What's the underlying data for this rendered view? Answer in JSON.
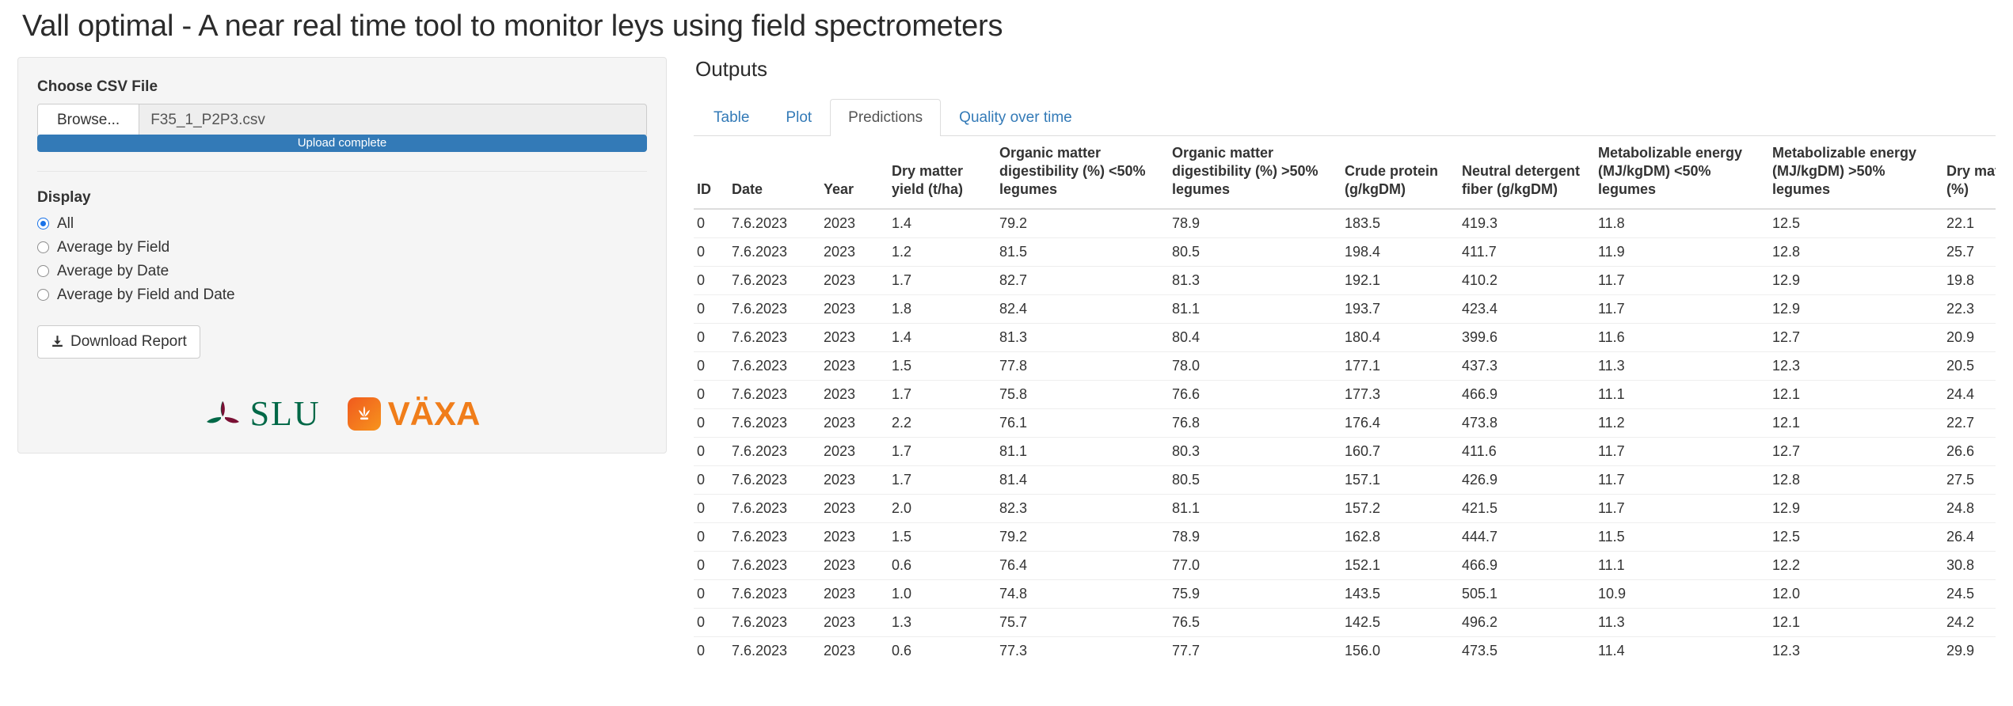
{
  "app": {
    "title": "Vall optimal - A near real time tool to monitor leys using field spectrometers"
  },
  "sidebar": {
    "file_label": "Choose CSV File",
    "browse_button": "Browse...",
    "file_name": "F35_1_P2P3.csv",
    "upload_status": "Upload complete",
    "display_label": "Display",
    "display_options": [
      {
        "label": "All",
        "selected": true
      },
      {
        "label": "Average by Field",
        "selected": false
      },
      {
        "label": "Average by Date",
        "selected": false
      },
      {
        "label": "Average by Field and Date",
        "selected": false
      }
    ],
    "download_button": "Download Report",
    "logos": [
      {
        "name": "slu-logo",
        "text": "SLU"
      },
      {
        "name": "vaxa-logo",
        "text": "VÄXA"
      }
    ]
  },
  "outputs": {
    "title": "Outputs",
    "tabs": [
      {
        "label": "Table",
        "active": false
      },
      {
        "label": "Plot",
        "active": false
      },
      {
        "label": "Predictions",
        "active": true
      },
      {
        "label": "Quality over time",
        "active": false
      }
    ],
    "table": {
      "columns": [
        "ID",
        "Date",
        "Year",
        "Dry matter yield (t/ha)",
        "Organic matter digestibility (%) <50% legumes",
        "Organic matter digestibility (%) >50% legumes",
        "Crude protein (g/kgDM)",
        "Neutral detergent fiber (g/kgDM)",
        "Metabolizable energy (MJ/kgDM) <50% legumes",
        "Metabolizable energy (MJ/kgDM) >50% legumes",
        "Dry matter (%)"
      ],
      "rows": [
        [
          "0",
          "7.6.2023",
          "2023",
          "1.4",
          "79.2",
          "78.9",
          "183.5",
          "419.3",
          "11.8",
          "12.5",
          "22.1"
        ],
        [
          "0",
          "7.6.2023",
          "2023",
          "1.2",
          "81.5",
          "80.5",
          "198.4",
          "411.7",
          "11.9",
          "12.8",
          "25.7"
        ],
        [
          "0",
          "7.6.2023",
          "2023",
          "1.7",
          "82.7",
          "81.3",
          "192.1",
          "410.2",
          "11.7",
          "12.9",
          "19.8"
        ],
        [
          "0",
          "7.6.2023",
          "2023",
          "1.8",
          "82.4",
          "81.1",
          "193.7",
          "423.4",
          "11.7",
          "12.9",
          "22.3"
        ],
        [
          "0",
          "7.6.2023",
          "2023",
          "1.4",
          "81.3",
          "80.4",
          "180.4",
          "399.6",
          "11.6",
          "12.7",
          "20.9"
        ],
        [
          "0",
          "7.6.2023",
          "2023",
          "1.5",
          "77.8",
          "78.0",
          "177.1",
          "437.3",
          "11.3",
          "12.3",
          "20.5"
        ],
        [
          "0",
          "7.6.2023",
          "2023",
          "1.7",
          "75.8",
          "76.6",
          "177.3",
          "466.9",
          "11.1",
          "12.1",
          "24.4"
        ],
        [
          "0",
          "7.6.2023",
          "2023",
          "2.2",
          "76.1",
          "76.8",
          "176.4",
          "473.8",
          "11.2",
          "12.1",
          "22.7"
        ],
        [
          "0",
          "7.6.2023",
          "2023",
          "1.7",
          "81.1",
          "80.3",
          "160.7",
          "411.6",
          "11.7",
          "12.7",
          "26.6"
        ],
        [
          "0",
          "7.6.2023",
          "2023",
          "1.7",
          "81.4",
          "80.5",
          "157.1",
          "426.9",
          "11.7",
          "12.8",
          "27.5"
        ],
        [
          "0",
          "7.6.2023",
          "2023",
          "2.0",
          "82.3",
          "81.1",
          "157.2",
          "421.5",
          "11.7",
          "12.9",
          "24.8"
        ],
        [
          "0",
          "7.6.2023",
          "2023",
          "1.5",
          "79.2",
          "78.9",
          "162.8",
          "444.7",
          "11.5",
          "12.5",
          "26.4"
        ],
        [
          "0",
          "7.6.2023",
          "2023",
          "0.6",
          "76.4",
          "77.0",
          "152.1",
          "466.9",
          "11.1",
          "12.2",
          "30.8"
        ],
        [
          "0",
          "7.6.2023",
          "2023",
          "1.0",
          "74.8",
          "75.9",
          "143.5",
          "505.1",
          "10.9",
          "12.0",
          "24.5"
        ],
        [
          "0",
          "7.6.2023",
          "2023",
          "1.3",
          "75.7",
          "76.5",
          "142.5",
          "496.2",
          "11.3",
          "12.1",
          "24.2"
        ],
        [
          "0",
          "7.6.2023",
          "2023",
          "0.6",
          "77.3",
          "77.7",
          "156.0",
          "473.5",
          "11.4",
          "12.3",
          "29.9"
        ]
      ]
    }
  }
}
